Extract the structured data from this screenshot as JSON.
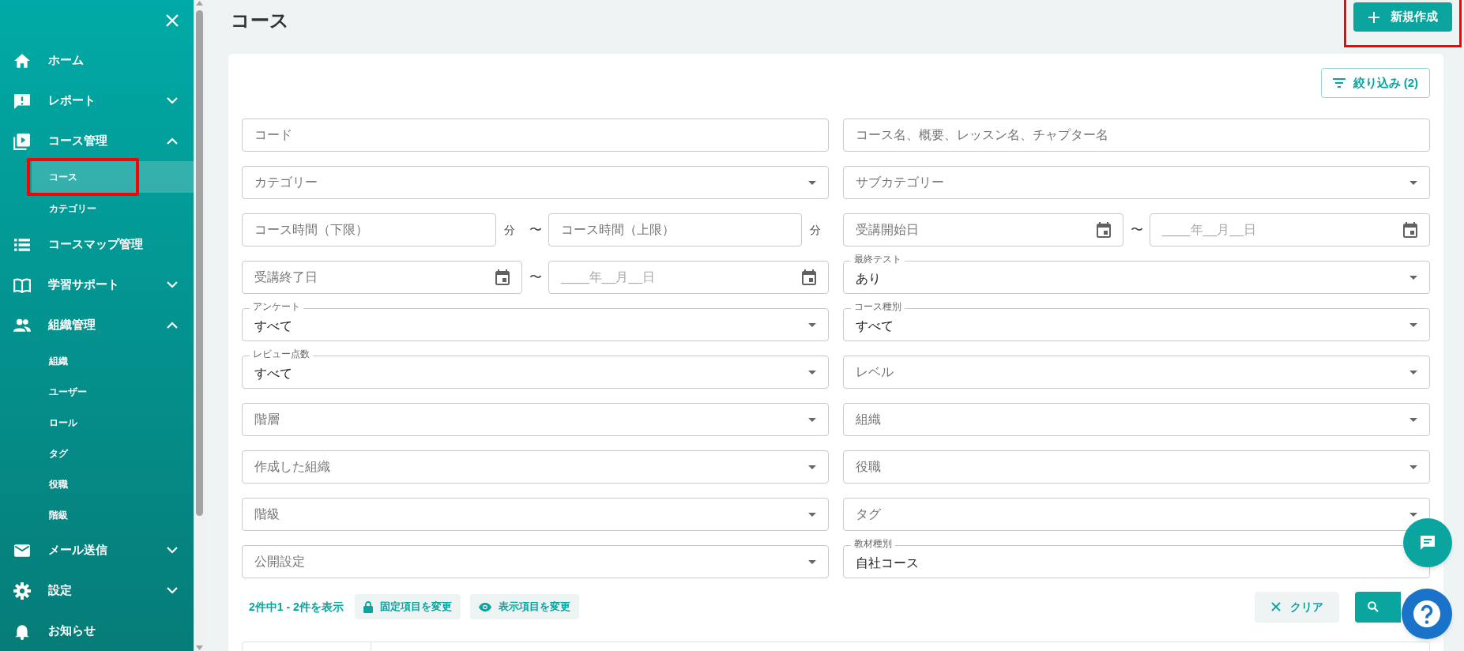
{
  "sidebar": {
    "items": [
      {
        "label": "ホーム"
      },
      {
        "label": "レポート",
        "expanded": false
      },
      {
        "label": "コース管理",
        "expanded": true,
        "children": [
          {
            "label": "コース",
            "selected": true
          },
          {
            "label": "カテゴリー",
            "selected": false
          }
        ]
      },
      {
        "label": "コースマップ管理"
      },
      {
        "label": "学習サポート",
        "expanded": false
      },
      {
        "label": "組織管理",
        "expanded": true,
        "children": [
          {
            "label": "組織",
            "selected": false
          },
          {
            "label": "ユーザー",
            "selected": false
          },
          {
            "label": "ロール",
            "selected": false
          },
          {
            "label": "タグ",
            "selected": false
          },
          {
            "label": "役職",
            "selected": false
          },
          {
            "label": "階級",
            "selected": false
          }
        ]
      },
      {
        "label": "メール送信",
        "expanded": false
      },
      {
        "label": "設定",
        "expanded": false
      },
      {
        "label": "お知らせ"
      }
    ]
  },
  "page_title": "コース",
  "new_button": {
    "label": "新規作成"
  },
  "filter_button": {
    "label": "絞り込み (2)"
  },
  "filter_rows": [
    {
      "left": {
        "kind": "text",
        "placeholder": "コード"
      },
      "right": {
        "kind": "text",
        "placeholder": "コース名、概要、レッスン名、チャプター名"
      }
    },
    {
      "left": {
        "kind": "select",
        "placeholder": "カテゴリー"
      },
      "right": {
        "kind": "select",
        "placeholder": "サブカテゴリー"
      }
    },
    {
      "left": {
        "kind": "minutes_range",
        "from_placeholder": "コース時間（下限）",
        "from_unit": "分",
        "separator": "〜",
        "to_placeholder": "コース時間（上限）",
        "to_unit": "分"
      },
      "right": {
        "kind": "date_range",
        "from_placeholder": "受講開始日",
        "separator": "〜",
        "to_placeholder": "____年__月__日"
      }
    },
    {
      "left": {
        "kind": "date_range",
        "from_placeholder": "受講終了日",
        "separator": "〜",
        "to_placeholder": "____年__月__日"
      },
      "right": {
        "kind": "select",
        "label": "最終テスト",
        "value": "あり"
      }
    },
    {
      "left": {
        "kind": "select",
        "label": "アンケート",
        "value": "すべて"
      },
      "right": {
        "kind": "select",
        "label": "コース種別",
        "value": "すべて"
      }
    },
    {
      "left": {
        "kind": "select",
        "label": "レビュー点数",
        "value": "すべて"
      },
      "right": {
        "kind": "select",
        "placeholder": "レベル"
      }
    },
    {
      "left": {
        "kind": "select",
        "placeholder": "階層"
      },
      "right": {
        "kind": "select",
        "placeholder": "組織"
      }
    },
    {
      "left": {
        "kind": "select",
        "placeholder": "作成した組織"
      },
      "right": {
        "kind": "select",
        "placeholder": "役職"
      }
    },
    {
      "left": {
        "kind": "select",
        "placeholder": "階級"
      },
      "right": {
        "kind": "select",
        "placeholder": "タグ"
      }
    },
    {
      "left": {
        "kind": "select",
        "placeholder": "公開設定"
      },
      "right": {
        "kind": "select",
        "label": "教材種別",
        "value": "自社コース"
      }
    }
  ],
  "result_count": "2件中1 - 2件を表示",
  "fixed_columns_button": {
    "label": "固定項目を変更"
  },
  "display_columns_button": {
    "label": "表示項目を変更"
  },
  "clear_button": {
    "label": "クリア"
  }
}
